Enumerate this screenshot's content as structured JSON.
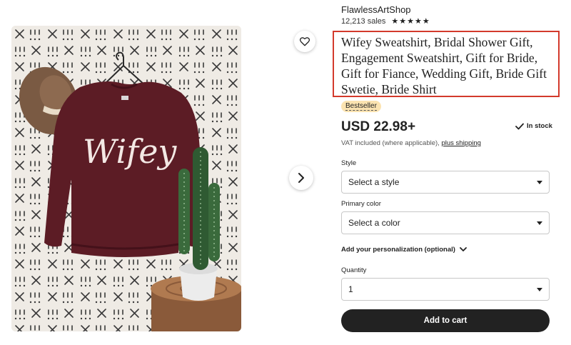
{
  "shop": {
    "name": "FlawlessArtShop",
    "sales": "12,213 sales",
    "stars": "★★★★★"
  },
  "product": {
    "title": "Wifey Sweatshirt, Bridal Shower Gift, Engagement Sweatshirt, Gift for Bride, Gift for Fiance, Wedding Gift, Bride Gift Swetie, Bride Shirt",
    "badge": "Bestseller",
    "price": "USD 22.98+",
    "stock": "In stock",
    "vat_text": "VAT included (where applicable), ",
    "vat_link": "plus shipping",
    "shirt_text": "Wifey"
  },
  "options": {
    "style_label": "Style",
    "style_value": "Select a style",
    "color_label": "Primary color",
    "color_value": "Select a color",
    "personalize_label": "Add your personalization (optional)",
    "quantity_label": "Quantity",
    "quantity_value": "1"
  },
  "actions": {
    "add_to_cart": "Add to cart"
  },
  "colors": {
    "sweatshirt": "#5c1c25",
    "button_dark": "#222222",
    "highlight_border": "#d33a2c",
    "badge_bg": "#fbe3b0"
  },
  "icons": {
    "favorite": "heart-icon",
    "next": "chevron-right-icon",
    "stock": "checkmark-icon",
    "personalize": "chevron-down-icon"
  }
}
